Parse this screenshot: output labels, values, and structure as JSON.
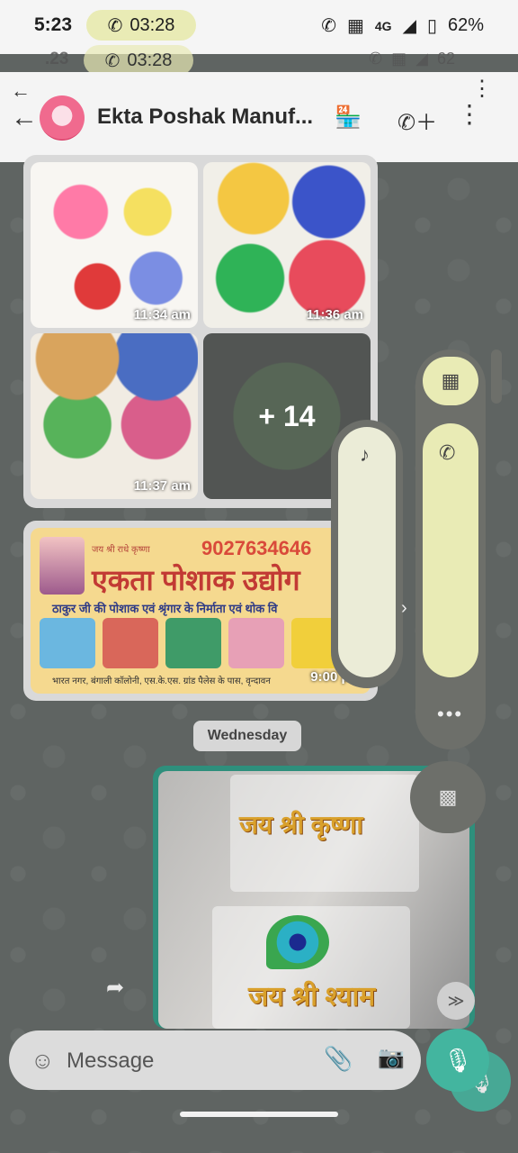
{
  "status_bar": {
    "time": "5:23",
    "call_timer": "03:28",
    "battery": "62%",
    "network": "4G",
    "ghost_time": ".23",
    "ghost_call_timer": "03:28",
    "ghost_battery": "62"
  },
  "header": {
    "title": "Ekta Poshak Manuf...",
    "icons": [
      "back-arrow-icon",
      "store-icon",
      "add-call-icon",
      "more-vert-icon"
    ]
  },
  "messages": {
    "grid_times": [
      "11:34 am",
      "11:36 am",
      "11:37 am"
    ],
    "more_count": "+ 14",
    "banner": {
      "small_text": "जय श्री राधे कृष्णा",
      "phone": "9027634646",
      "title": "एकता पोशाक उद्योग",
      "line2": "ठाकुर जी की पोशाक एवं श्रृंगार के निर्माता एवं थोक वि",
      "line3": "भारत नगर, बंगाली कॉलोनी, एस.के.एस. ग्रांड पैलेस के पास, वृन्दावन",
      "time": "9:00 pm"
    },
    "date_chip": "Wednesday",
    "photo_texts": [
      "जय श्री कृष्णा",
      "जय श्री श्याम"
    ]
  },
  "volume_panel": {
    "icons": [
      "vibrate-icon",
      "phone-icon",
      "music-note-icon",
      "more-horiz-icon",
      "captions-off-icon"
    ],
    "more": "•••"
  },
  "composer": {
    "placeholder": "Message",
    "icons": [
      "emoji-icon",
      "attach-icon",
      "camera-icon",
      "mic-icon"
    ]
  }
}
